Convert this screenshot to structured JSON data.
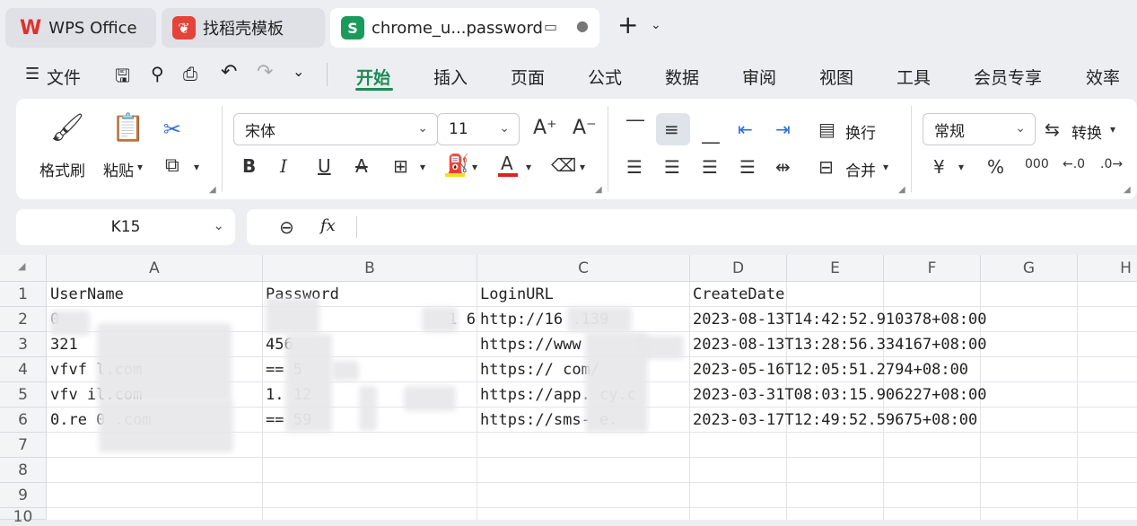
{
  "tabs": [
    {
      "label": "WPS Office",
      "icon": "wps-logo-icon"
    },
    {
      "label": "找稻壳模板",
      "icon": "docer-icon"
    },
    {
      "label": "chrome_u...password",
      "icon": "spreadsheet-icon",
      "icon_letter": "S"
    }
  ],
  "menu": {
    "file": "文件",
    "items": [
      "开始",
      "插入",
      "页面",
      "公式",
      "数据",
      "审阅",
      "视图",
      "工具",
      "会员专享",
      "效率"
    ],
    "active": "开始"
  },
  "ribbon": {
    "format_painter": "格式刷",
    "paste": "粘贴",
    "font_name": "宋体",
    "font_size": "11",
    "wrap": "换行",
    "merge": "合并",
    "number_format": "常规",
    "convert": "转换",
    "accent_color": "#1a8c52"
  },
  "formula_bar": {
    "cell_ref": "K15",
    "fx": "fx",
    "value": ""
  },
  "sheet": {
    "columns": [
      "A",
      "B",
      "C",
      "D",
      "E",
      "F",
      "G",
      "H"
    ],
    "rows": [
      "1",
      "2",
      "3",
      "4",
      "5",
      "6",
      "7",
      "8",
      "9",
      "10"
    ],
    "cells": [
      {
        "col": "A",
        "row": 1,
        "text": "UserName"
      },
      {
        "col": "B",
        "row": 1,
        "text": "Password"
      },
      {
        "col": "C",
        "row": 1,
        "text": "LoginURL"
      },
      {
        "col": "D",
        "row": 1,
        "text": "CreateDate"
      },
      {
        "col": "A",
        "row": 2,
        "text": "0"
      },
      {
        "col": "B",
        "row": 2,
        "text": "1      6"
      },
      {
        "col": "C",
        "row": 2,
        "text": "http://16      .139"
      },
      {
        "col": "D",
        "row": 2,
        "text": "2023-08-13T14:42:52.910378+08:00"
      },
      {
        "col": "A",
        "row": 3,
        "text": "          321"
      },
      {
        "col": "B",
        "row": 3,
        "text": "      456"
      },
      {
        "col": "C",
        "row": 3,
        "text": "https://www"
      },
      {
        "col": "D",
        "row": 3,
        "text": "2023-08-13T13:28:56.334167+08:00"
      },
      {
        "col": "A",
        "row": 4,
        "text": "vfvf         l.com"
      },
      {
        "col": "B",
        "row": 4,
        "text": "==  5"
      },
      {
        "col": "C",
        "row": 4,
        "text": "https://        com/"
      },
      {
        "col": "D",
        "row": 4,
        "text": "2023-05-16T12:05:51.2794+08:00"
      },
      {
        "col": "A",
        "row": 5,
        "text": "vfv          il.com"
      },
      {
        "col": "B",
        "row": 5,
        "text": "          1.      12"
      },
      {
        "col": "C",
        "row": 5,
        "text": "https://app.      cy.c"
      },
      {
        "col": "D",
        "row": 5,
        "text": "2023-03-31T08:03:15.906227+08:00"
      },
      {
        "col": "A",
        "row": 6,
        "text": "0.re    0        .com"
      },
      {
        "col": "B",
        "row": 6,
        "text": "==    59"
      },
      {
        "col": "C",
        "row": 6,
        "text": "https://sms-       e."
      },
      {
        "col": "D",
        "row": 6,
        "text": "2023-03-17T12:49:52.59675+08:00"
      }
    ]
  }
}
